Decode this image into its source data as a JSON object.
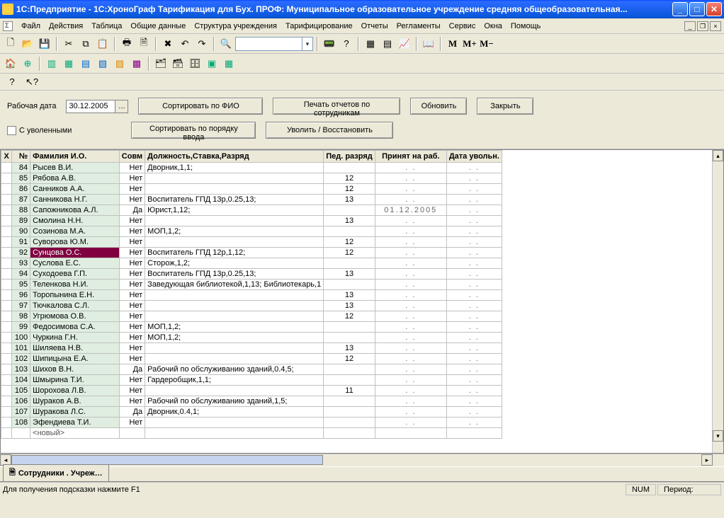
{
  "title": "1С:Предприятие  -  1С:ХроноГраф Тарификация для Бух. ПРОФ: Муниципальное образовательное учреждение средняя общеобразовательная...",
  "menu": [
    "Файл",
    "Действия",
    "Таблица",
    "Общие данные",
    "Структура учреждения",
    "Тарифицирование",
    "Отчеты",
    "Регламенты",
    "Сервис",
    "Окна",
    "Помощь"
  ],
  "form": {
    "workdate_label": "Рабочая дата",
    "workdate_value": "30.12.2005",
    "sort_fio": "Сортировать по ФИО",
    "print_reports": "Печать отчетов по сотрудникам",
    "refresh": "Обновить",
    "close": "Закрыть",
    "with_fired": "С уволенными",
    "sort_input": "Сортировать по порядку ввода",
    "fire_restore": "Уволить / Восстановить"
  },
  "columns": {
    "x": "X",
    "n": "№",
    "fio": "Фамилия И.О.",
    "sovm": "Совм",
    "dol": "Должность,Ставка,Разряд",
    "ped": "Пед. разряд",
    "prin": "Принят на раб.",
    "uvol": "Дата увольн."
  },
  "rows": [
    {
      "n": "84",
      "fio": "Рысев В.И.",
      "sovm": "Нет",
      "dol": "Дворник,1,1;",
      "ped": "",
      "prin": ". .",
      "uvol": ". ."
    },
    {
      "n": "85",
      "fio": "Рябова А.В.",
      "sovm": "Нет",
      "dol": "",
      "ped": "12",
      "prin": ". .",
      "uvol": ". ."
    },
    {
      "n": "86",
      "fio": "Санников А.А.",
      "sovm": "Нет",
      "dol": "",
      "ped": "12",
      "prin": ". .",
      "uvol": ". ."
    },
    {
      "n": "87",
      "fio": "Санникова Н.Г.",
      "sovm": "Нет",
      "dol": "Воспитатель ГПД 13р,0.25,13;",
      "ped": "13",
      "prin": ". .",
      "uvol": ". ."
    },
    {
      "n": "88",
      "fio": "Сапожникова А.Л.",
      "sovm": "Да",
      "dol": "Юрист,1,12;",
      "ped": "",
      "prin": "01.12.2005",
      "uvol": ". ."
    },
    {
      "n": "89",
      "fio": "Смолина Н.Н.",
      "sovm": "Нет",
      "dol": "",
      "ped": "13",
      "prin": ". .",
      "uvol": ". ."
    },
    {
      "n": "90",
      "fio": "Созинова М.А.",
      "sovm": "Нет",
      "dol": "МОП,1,2;",
      "ped": "",
      "prin": ". .",
      "uvol": ". ."
    },
    {
      "n": "91",
      "fio": "Суворова Ю.М.",
      "sovm": "Нет",
      "dol": "",
      "ped": "12",
      "prin": ". .",
      "uvol": ". ."
    },
    {
      "n": "92",
      "fio": "Сунцова О.С.",
      "sovm": "Нет",
      "dol": "Воспитатель ГПД 12р,1,12;",
      "ped": "12",
      "prin": ". .",
      "uvol": ". .",
      "sel": true
    },
    {
      "n": "93",
      "fio": "Суслова Е.С.",
      "sovm": "Нет",
      "dol": "Сторож,1,2;",
      "ped": "",
      "prin": ". .",
      "uvol": ". ."
    },
    {
      "n": "94",
      "fio": "Суходоева Г.П.",
      "sovm": "Нет",
      "dol": "Воспитатель ГПД 13р,0.25,13;",
      "ped": "13",
      "prin": ". .",
      "uvol": ". ."
    },
    {
      "n": "95",
      "fio": "Теленкова Н.И.",
      "sovm": "Нет",
      "dol": "Заведующая библиотекой,1,13; Библиотекарь,1",
      "ped": "",
      "prin": ". .",
      "uvol": ". ."
    },
    {
      "n": "96",
      "fio": "Торопынина Е.Н.",
      "sovm": "Нет",
      "dol": "",
      "ped": "13",
      "prin": ". .",
      "uvol": ". ."
    },
    {
      "n": "97",
      "fio": "Тючкалова С.Л.",
      "sovm": "Нет",
      "dol": "",
      "ped": "13",
      "prin": ". .",
      "uvol": ". ."
    },
    {
      "n": "98",
      "fio": "Угрюмова О.В.",
      "sovm": "Нет",
      "dol": "",
      "ped": "12",
      "prin": ". .",
      "uvol": ". ."
    },
    {
      "n": "99",
      "fio": "Федосимова С.А.",
      "sovm": "Нет",
      "dol": "МОП,1,2;",
      "ped": "",
      "prin": ". .",
      "uvol": ". ."
    },
    {
      "n": "100",
      "fio": "Чуркина Г.Н.",
      "sovm": "Нет",
      "dol": "МОП,1,2;",
      "ped": "",
      "prin": ". .",
      "uvol": ". ."
    },
    {
      "n": "101",
      "fio": "Шиляева Н.В.",
      "sovm": "Нет",
      "dol": "",
      "ped": "13",
      "prin": ". .",
      "uvol": ". ."
    },
    {
      "n": "102",
      "fio": "Шипицына Е.А.",
      "sovm": "Нет",
      "dol": "",
      "ped": "12",
      "prin": ". .",
      "uvol": ". ."
    },
    {
      "n": "103",
      "fio": "Шихов В.Н.",
      "sovm": "Да",
      "dol": "Рабочий по обслуживанию зданий,0.4,5;",
      "ped": "",
      "prin": ". .",
      "uvol": ". ."
    },
    {
      "n": "104",
      "fio": "Шмырина Т.И.",
      "sovm": "Нет",
      "dol": "Гардеробщик,1,1;",
      "ped": "",
      "prin": ". .",
      "uvol": ". ."
    },
    {
      "n": "105",
      "fio": "Шорохова Л.В.",
      "sovm": "Нет",
      "dol": "",
      "ped": "11",
      "prin": ". .",
      "uvol": ". ."
    },
    {
      "n": "106",
      "fio": "Шураков А.В.",
      "sovm": "Нет",
      "dol": "Рабочий по обслуживанию зданий,1,5;",
      "ped": "",
      "prin": ". .",
      "uvol": ". ."
    },
    {
      "n": "107",
      "fio": "Шуракова Л.С.",
      "sovm": "Да",
      "dol": "Дворник,0.4,1;",
      "ped": "",
      "prin": ". .",
      "uvol": ". ."
    },
    {
      "n": "108",
      "fio": "Эфендиева Т.И.",
      "sovm": "Нет",
      "dol": "",
      "ped": "",
      "prin": ". .",
      "uvol": ". ."
    }
  ],
  "newrow": "<новый>",
  "tab": "Сотрудники . Учреж…",
  "status": {
    "hint": "Для получения подсказки нажмите F1",
    "num": "NUM",
    "period": "Период:"
  }
}
